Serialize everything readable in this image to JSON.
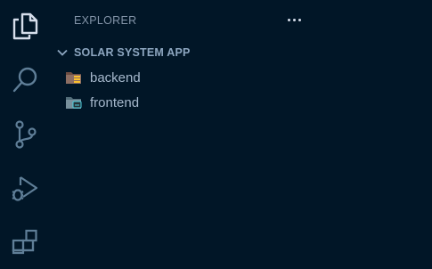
{
  "activity_bar": {
    "items": [
      {
        "icon": "files-icon",
        "active": true
      },
      {
        "icon": "search-icon",
        "active": false
      },
      {
        "icon": "source-control-icon",
        "active": false
      },
      {
        "icon": "run-debug-icon",
        "active": false
      },
      {
        "icon": "extensions-icon",
        "active": false
      }
    ]
  },
  "explorer": {
    "title": "EXPLORER",
    "more_actions_icon": "ellipsis-icon",
    "workspace": {
      "name": "SOLAR SYSTEM APP",
      "expanded": true,
      "items": [
        {
          "label": "backend",
          "icon": "folder-backend-icon"
        },
        {
          "label": "frontend",
          "icon": "folder-frontend-icon"
        }
      ]
    }
  },
  "colors": {
    "background": "#011627",
    "active_icon": "#d6deeb",
    "inactive_icon": "#5f7e97",
    "header_text": "#8394a8",
    "item_text": "#a6b8cc"
  }
}
